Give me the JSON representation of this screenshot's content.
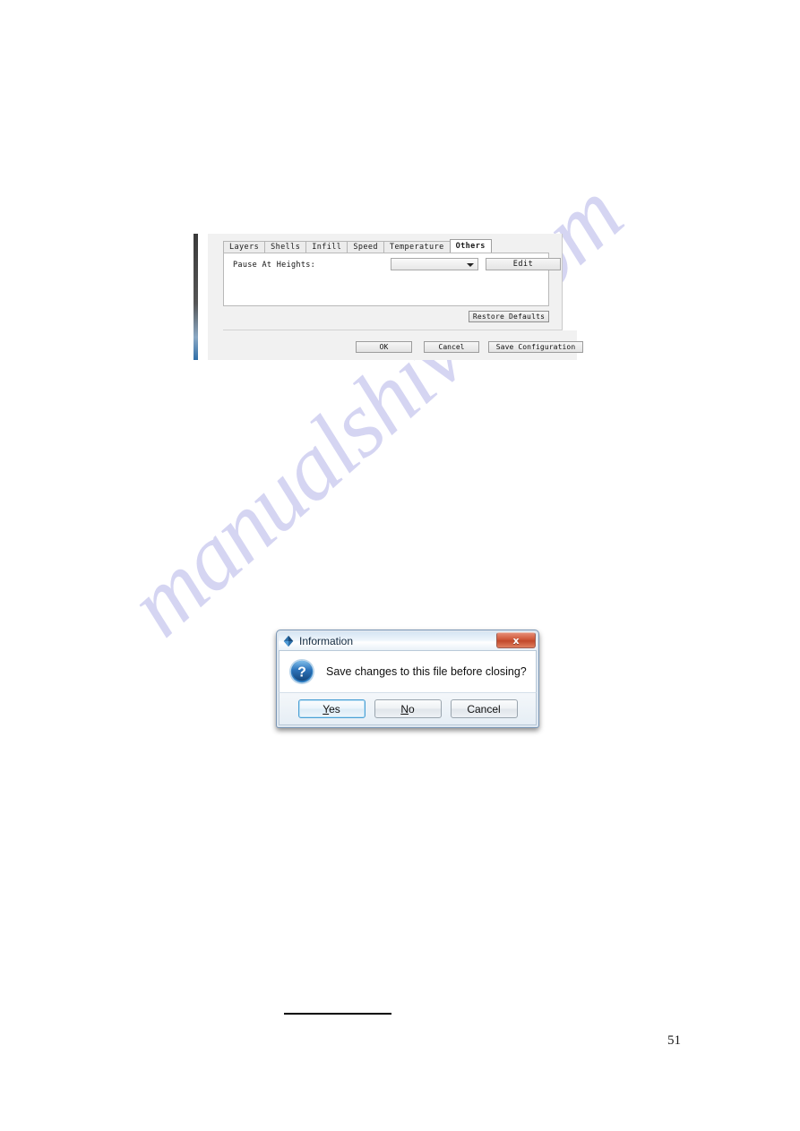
{
  "page": {
    "number": "51",
    "watermark": "manualshive.com"
  },
  "settings_window": {
    "tabs": [
      {
        "label": "Layers",
        "active": false
      },
      {
        "label": "Shells",
        "active": false
      },
      {
        "label": "Infill",
        "active": false
      },
      {
        "label": "Speed",
        "active": false
      },
      {
        "label": "Temperature",
        "active": false
      },
      {
        "label": "Others",
        "active": true
      }
    ],
    "panel": {
      "field_label": "Pause At Heights:",
      "dropdown_value": "",
      "dropdown_placeholder": "",
      "edit_button": "Edit"
    },
    "restore_defaults_button": "Restore Defaults",
    "footer_buttons": {
      "ok": "OK",
      "cancel": "Cancel",
      "save_configuration": "Save Configuration"
    }
  },
  "info_dialog": {
    "title": "Information",
    "title_icon": "app-diamond-icon",
    "close_icon": "close-icon",
    "close_label": "x",
    "message_icon": "question-icon",
    "message": "Save changes to this file before closing?",
    "buttons": {
      "yes_prefix": "",
      "yes_accel": "Y",
      "yes_suffix": "es",
      "no_prefix": "",
      "no_accel": "N",
      "no_suffix": "o",
      "cancel": "Cancel"
    }
  },
  "colors": {
    "dialog_border": "#7b97b5",
    "close_button": "#c24a2c",
    "focus_ring": "#4a9fd4",
    "watermark": "#c8c8ee"
  }
}
